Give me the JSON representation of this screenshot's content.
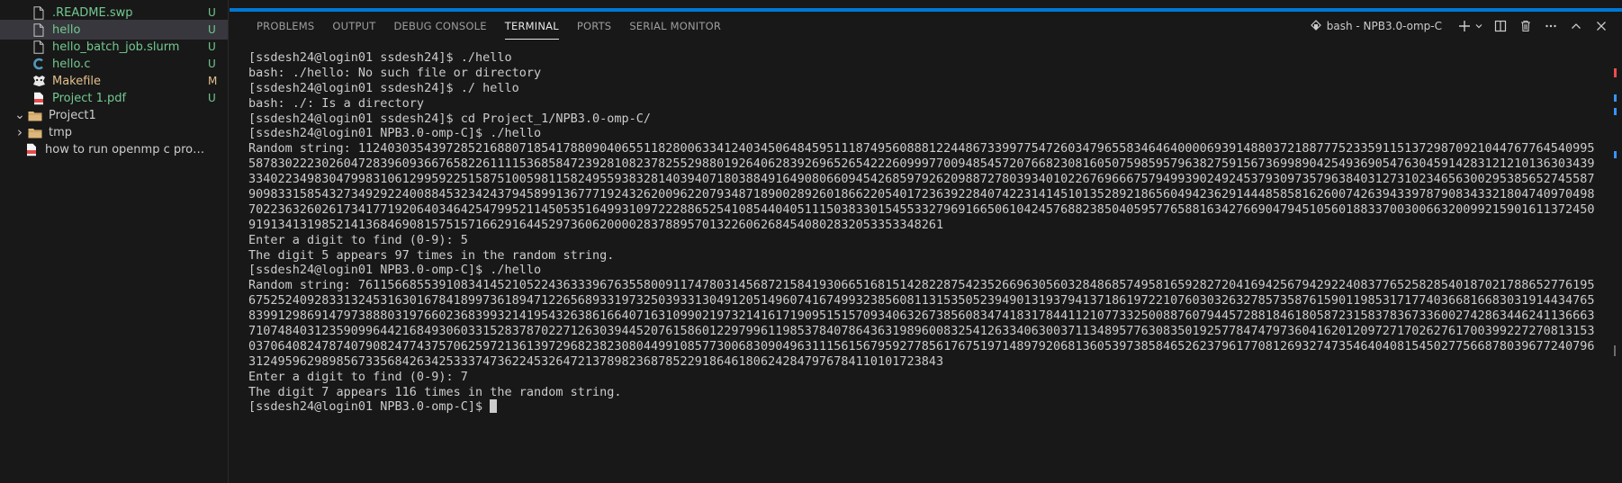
{
  "explorer": {
    "items": [
      {
        "name": "readme-swp-file",
        "label": ".README.swp",
        "icon": "file-icon",
        "status": "U",
        "kind": "u"
      },
      {
        "name": "hello-file",
        "label": "hello",
        "icon": "file-icon",
        "status": "U",
        "kind": "u",
        "selected": true
      },
      {
        "name": "hello-batch-job-file",
        "label": "hello_batch_job.slurm",
        "icon": "file-icon",
        "status": "U",
        "kind": "u"
      },
      {
        "name": "hello-c-file",
        "label": "hello.c",
        "icon": "c-file-icon",
        "status": "U",
        "kind": "u"
      },
      {
        "name": "makefile-file",
        "label": "Makefile",
        "icon": "makefile-icon",
        "status": "M",
        "kind": "m"
      },
      {
        "name": "project-1-pdf-file",
        "label": "Project 1.pdf",
        "icon": "pdf-icon",
        "status": "U",
        "kind": "u"
      },
      {
        "name": "project1-folder",
        "label": "Project1",
        "icon": "folder-icon",
        "status": "",
        "kind": "plain",
        "chevron": "expanded"
      },
      {
        "name": "tmp-folder",
        "label": "tmp",
        "icon": "folder-icon",
        "status": "",
        "kind": "plain",
        "chevron": "collapsed"
      },
      {
        "name": "how-to-run-openmp-file",
        "label": "how to run openmp c program....",
        "icon": "pdf-icon",
        "status": "",
        "kind": "plain"
      }
    ]
  },
  "panel": {
    "tabs": [
      {
        "label": "PROBLEMS",
        "active": false
      },
      {
        "label": "OUTPUT",
        "active": false
      },
      {
        "label": "DEBUG CONSOLE",
        "active": false
      },
      {
        "label": "TERMINAL",
        "active": true
      },
      {
        "label": "PORTS",
        "active": false
      },
      {
        "label": "SERIAL MONITOR",
        "active": false
      }
    ],
    "terminal_title": "bash - NPB3.0-omp-C",
    "actions": [
      "new-terminal-icon",
      "chevron-down-icon",
      "split-terminal-icon",
      "trash-icon",
      "more-icon",
      "maximize-panel-icon",
      "close-icon"
    ]
  },
  "terminal": {
    "lines": [
      {
        "deco": "",
        "text": "[ssdesh24@login01 ssdesh24]$ ./hello"
      },
      {
        "deco": "",
        "text": "bash: ./hello: No such file or directory"
      },
      {
        "deco": "err",
        "text": "[ssdesh24@login01 ssdesh24]$ ./ hello"
      },
      {
        "deco": "",
        "text": "bash: ./: Is a directory"
      },
      {
        "deco": "ok",
        "text": "[ssdesh24@login01 ssdesh24]$ cd Project_1/NPB3.0-omp-C/"
      },
      {
        "deco": "ok",
        "text": "[ssdesh24@login01 NPB3.0-omp-C]$ ./hello"
      },
      {
        "deco": "",
        "text": "Random string: 1124030354397285216880718541788090406551182800633412403450648459511187495608881224486733997754726034796558346464000069391488037218877752335911513729870921044767764540995587830222302604728396093667658226111153685847239281082378255298801926406283926965265422260999770094854572076682308160507598595796382759156736998904254936905476304591428312121013630343933402234983047998310612995922515875100598115824955938328140394071803884916490806609454268597926209887278039340102267696667579499390249245379309735796384031273102346563002953856527455879098331585432734929224008845323424379458991367771924326200962207934871890028926018662205401723639228407422314145101352892186560494236291444858581626007426394339787908343321804740970498702236326026173417719206403464254799521145053516499310972228865254108544040511150383301545533279691665061042457688238504059577658816342766904794510560188337003006632009921590161137245091913413198521413684690815751571662916445297360620000283788957013226062684540802832053353348261"
      },
      {
        "deco": "",
        "text": "Enter a digit to find (0-9): 5"
      },
      {
        "deco": "",
        "text": "The digit 5 appears 97 times in the random string."
      },
      {
        "deco": "ok",
        "text": "[ssdesh24@login01 NPB3.0-omp-C]$ ./hello"
      },
      {
        "deco": "",
        "text": "Random string: 7611566855391083414521052243633396763558009117478031456872158419306651681514282287542352669630560328486857495816592827204169425679429224083776525828540187021788652776195675252409283313245316301678418997361894712265689331973250393313049120514960741674993238560811315350523949013193794137186197221076030326327857358761590119853171774036681668303191443476583991298691479738880319766023683993214195432638616640716310990219732141617190951515709340632673856083474183178441121077332500887607944572881846180587231583783673360027428634462411366637107484031235909964421684930603315283787022712630394452076158601229799611985378407864363198960083254126334063003711348957763083501925778474797360416201209727170262761700399227270813153037064082478740790824774375706259721361397296823823080449910857730068309049631115615679592778561767519714897920681360539738584652623796177081269327473546404081545027756687803967724079631249596298985673356842634253337473622453264721378982368785229186461806242847976784110101723843"
      },
      {
        "deco": "",
        "text": "Enter a digit to find (0-9): 7"
      },
      {
        "deco": "",
        "text": "The digit 7 appears 116 times in the random string."
      },
      {
        "deco": "pending",
        "text": "[ssdesh24@login01 NPB3.0-omp-C]$ ",
        "cursor": true
      }
    ]
  }
}
